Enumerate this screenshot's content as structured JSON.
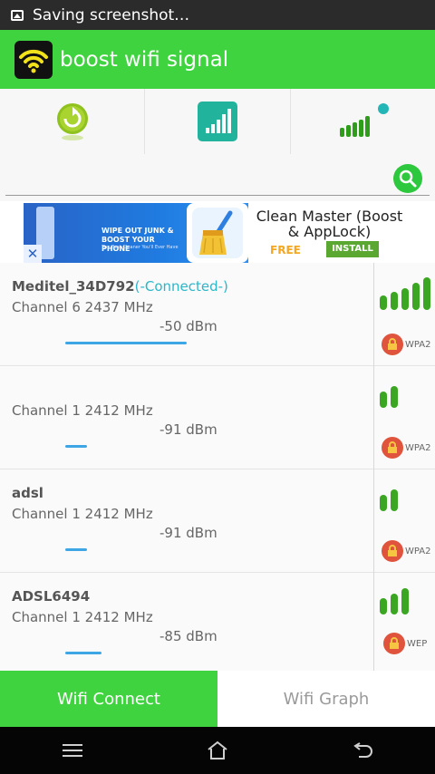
{
  "status_bar": {
    "text": "Saving screenshot…"
  },
  "app": {
    "title": "boost wifi signal"
  },
  "ad": {
    "banner_line1": "WIPE OUT JUNK & BOOST YOUR PHONE",
    "banner_line2": "The Best Cleaner You'll Ever Have",
    "app_name": "Clean Master (Boost & AppLock)",
    "price": "FREE",
    "install_label": "INSTALL",
    "close_symbol": "✕"
  },
  "networks": [
    {
      "name": "Meditel_34D792",
      "status": "(-Connected-)",
      "channel": "Channel 6 2437 MHz",
      "dbm": "-50 dBm",
      "security": "WPA2",
      "signal_level": 5,
      "strength": 0.7
    },
    {
      "name": "",
      "status": "",
      "channel": "Channel 1 2412 MHz",
      "dbm": "-91 dBm",
      "security": "WPA2",
      "signal_level": 2,
      "strength": 0.13
    },
    {
      "name": "adsl",
      "status": "",
      "channel": "Channel 1 2412 MHz",
      "dbm": "-91 dBm",
      "security": "WPA2",
      "signal_level": 2,
      "strength": 0.13
    },
    {
      "name": "ADSL6494",
      "status": "",
      "channel": "Channel 1 2412 MHz",
      "dbm": "-85 dBm",
      "security": "WEP",
      "signal_level": 3,
      "strength": 0.21
    }
  ],
  "tabs": [
    {
      "label": "Wifi Connect",
      "active": true
    },
    {
      "label": "Wifi Graph",
      "active": false
    }
  ],
  "colors": {
    "primary": "#3fd33f",
    "connected": "#2db6c8",
    "bar": "#3fa6e6",
    "lock": "#e0533c"
  },
  "icons": [
    "image-icon",
    "wifi-logo-icon",
    "refresh-icon",
    "signal-chart-icon",
    "signal-bars-icon",
    "search-icon",
    "lock-icon",
    "menu-icon",
    "home-icon",
    "back-icon"
  ]
}
